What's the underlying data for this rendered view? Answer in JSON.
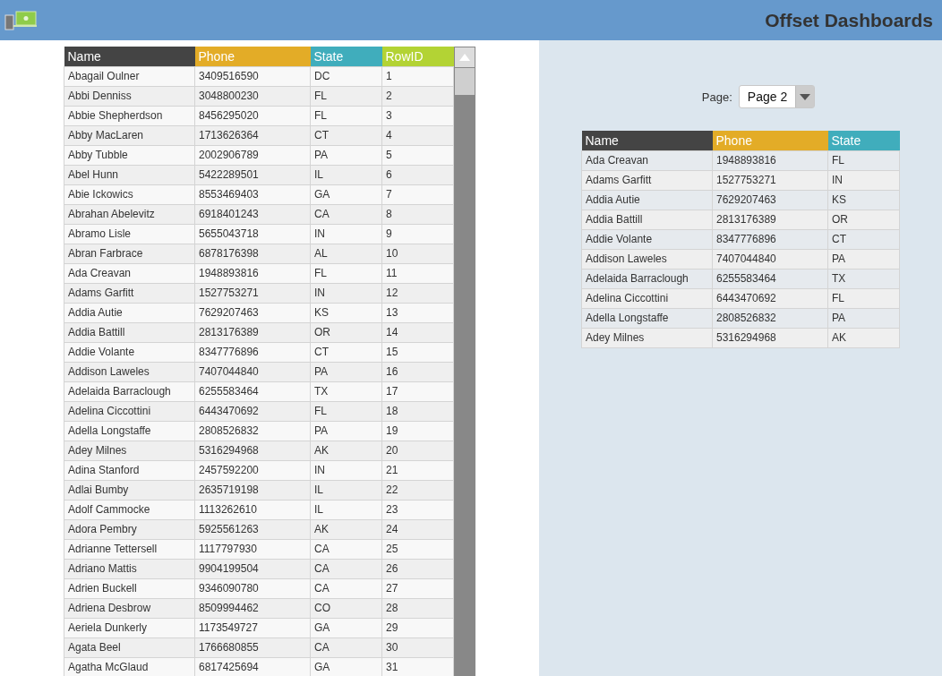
{
  "header": {
    "title": "Offset Dashboards"
  },
  "main_table": {
    "columns": [
      {
        "label": "Name",
        "color": "#444444"
      },
      {
        "label": "Phone",
        "color": "#e3ac27"
      },
      {
        "label": "State",
        "color": "#40adbc"
      },
      {
        "label": "RowID",
        "color": "#b3d334"
      }
    ],
    "rows": [
      [
        "Abagail Oulner",
        "3409516590",
        "DC",
        "1"
      ],
      [
        "Abbi Denniss",
        "3048800230",
        "FL",
        "2"
      ],
      [
        "Abbie Shepherdson",
        "8456295020",
        "FL",
        "3"
      ],
      [
        "Abby MacLaren",
        "1713626364",
        "CT",
        "4"
      ],
      [
        "Abby Tubble",
        "2002906789",
        "PA",
        "5"
      ],
      [
        "Abel Hunn",
        "5422289501",
        "IL",
        "6"
      ],
      [
        "Abie Ickowics",
        "8553469403",
        "GA",
        "7"
      ],
      [
        "Abrahan Abelevitz",
        "6918401243",
        "CA",
        "8"
      ],
      [
        "Abramo Lisle",
        "5655043718",
        "IN",
        "9"
      ],
      [
        "Abran Farbrace",
        "6878176398",
        "AL",
        "10"
      ],
      [
        "Ada Creavan",
        "1948893816",
        "FL",
        "11"
      ],
      [
        "Adams Garfitt",
        "1527753271",
        "IN",
        "12"
      ],
      [
        "Addia Autie",
        "7629207463",
        "KS",
        "13"
      ],
      [
        "Addia Battill",
        "2813176389",
        "OR",
        "14"
      ],
      [
        "Addie Volante",
        "8347776896",
        "CT",
        "15"
      ],
      [
        "Addison Laweles",
        "7407044840",
        "PA",
        "16"
      ],
      [
        "Adelaida Barraclough",
        "6255583464",
        "TX",
        "17"
      ],
      [
        "Adelina Ciccottini",
        "6443470692",
        "FL",
        "18"
      ],
      [
        "Adella Longstaffe",
        "2808526832",
        "PA",
        "19"
      ],
      [
        "Adey Milnes",
        "5316294968",
        "AK",
        "20"
      ],
      [
        "Adina Stanford",
        "2457592200",
        "IN",
        "21"
      ],
      [
        "Adlai Bumby",
        "2635719198",
        "IL",
        "22"
      ],
      [
        "Adolf Cammocke",
        "1113262610",
        "IL",
        "23"
      ],
      [
        "Adora Pembry",
        "5925561263",
        "AK",
        "24"
      ],
      [
        "Adrianne Tettersell",
        "1117797930",
        "CA",
        "25"
      ],
      [
        "Adriano Mattis",
        "9904199504",
        "CA",
        "26"
      ],
      [
        "Adrien Buckell",
        "9346090780",
        "CA",
        "27"
      ],
      [
        "Adriena Desbrow",
        "8509994462",
        "CO",
        "28"
      ],
      [
        "Aeriela Dunkerly",
        "1173549727",
        "GA",
        "29"
      ],
      [
        "Agata Beel",
        "1766680855",
        "CA",
        "30"
      ],
      [
        "Agatha McGlaud",
        "6817425694",
        "GA",
        "31"
      ]
    ]
  },
  "pager": {
    "label": "Page:",
    "value": "Page 2"
  },
  "page_table": {
    "columns": [
      {
        "label": "Name",
        "color": "#444444"
      },
      {
        "label": "Phone",
        "color": "#e3ac27"
      },
      {
        "label": "State",
        "color": "#40adbc"
      }
    ],
    "rows": [
      [
        "Ada Creavan",
        "1948893816",
        "FL"
      ],
      [
        "Adams Garfitt",
        "1527753271",
        "IN"
      ],
      [
        "Addia Autie",
        "7629207463",
        "KS"
      ],
      [
        "Addia Battill",
        "2813176389",
        "OR"
      ],
      [
        "Addie Volante",
        "8347776896",
        "CT"
      ],
      [
        "Addison Laweles",
        "7407044840",
        "PA"
      ],
      [
        "Adelaida Barraclough",
        "6255583464",
        "TX"
      ],
      [
        "Adelina Ciccottini",
        "6443470692",
        "FL"
      ],
      [
        "Adella Longstaffe",
        "2808526832",
        "PA"
      ],
      [
        "Adey Milnes",
        "5316294968",
        "AK"
      ]
    ]
  }
}
